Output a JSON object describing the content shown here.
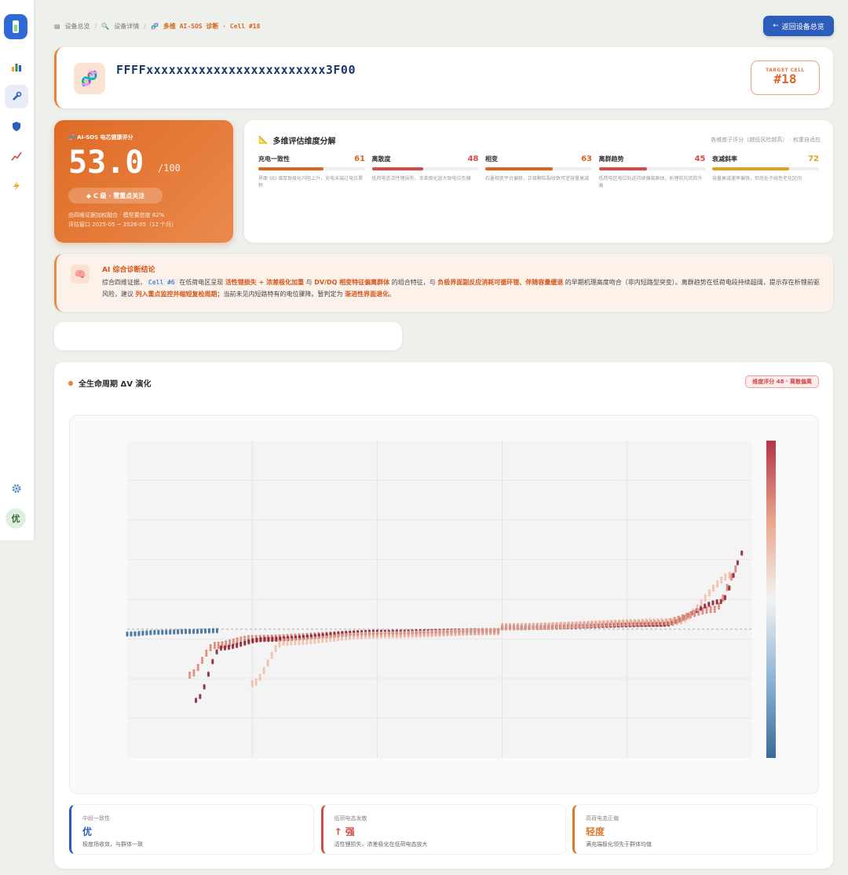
{
  "breadcrumb": {
    "items": [
      {
        "icon": "grid-icon",
        "label": "设备总览"
      },
      {
        "icon": "search-icon",
        "label": "设备详情"
      },
      {
        "icon": "dna-icon",
        "label": "多维 AI-SOS 诊断 · Cell #18"
      }
    ],
    "back_label": "返回设备总览"
  },
  "sidebar": {
    "avatar_label": "优"
  },
  "header": {
    "device_id": "FFFFxxxxxxxxxxxxxxxxxxxxxxxx3F00",
    "target_label": "TARGET CELL",
    "target_value": "#18"
  },
  "score": {
    "title": "AI-SOS 电芯健康评分",
    "value": "53.0",
    "max": "/100",
    "grade": "C 级 · 需重点关注",
    "meta1": "由四维证据加权融合 · 模型置信度 82%",
    "meta2": "评估窗口 2025-05 ~ 2026-05（12 个月）"
  },
  "dimensions": {
    "title": "多维评估维度分解",
    "note": "各维度子评分（越低风险越高） · 权重自适应",
    "items": [
      {
        "name": "充电一致性",
        "score": "61",
        "fraction": 0.61,
        "color": "#d9651f",
        "desc": "界面 SEI 增厚致极化内阻上升，充电末端过电位累积"
      },
      {
        "name": "离散度",
        "score": "48",
        "fraction": 0.48,
        "color": "#d74a4a",
        "desc": "低荷电态活性锂损失，浓差极化放大致电位负偏"
      },
      {
        "name": "相变",
        "score": "63",
        "fraction": 0.63,
        "color": "#d9651f",
        "desc": "石墨相变平台偏移，正极颗粒裂纹致可逆容量衰减"
      },
      {
        "name": "离群趋势",
        "score": "45",
        "fraction": 0.45,
        "color": "#d74a4a",
        "desc": "低荷电区电位轨迹持续偏离群体，析锂前兆风险升高"
      },
      {
        "name": "衰减斜率",
        "score": "72",
        "fraction": 0.72,
        "color": "#e0a21e",
        "desc": "容量衰减速率偏快，但尚处于线性老化区间"
      }
    ]
  },
  "diagnosis": {
    "title": "AI 综合诊断结论",
    "p1": "综合四维证据，",
    "cell": "Cell #6",
    "p2": " 在低荷电区呈现 ",
    "h1": "活性锂损失 + 浓差极化加重",
    "p3": " 与 ",
    "h2": "DV/DQ 相变特征偏离群体",
    "p4": " 的组合特征，与 ",
    "h3": "负极界面副反应消耗可循环锂、伴随容量缓退",
    "p5": " 的早期机理高度吻合（非内短路型突变）。离群趋势在低荷电段持续超阈，提示存在析锂前驱风险，建议 ",
    "h4": "列入重点监控并缩短复检周期",
    "p6": "；当前未见内短路特有的电位骤降。暂判定为 ",
    "h5": "渐进性界面退化",
    "p7": "。"
  },
  "chart_panel": {
    "title": "全生命周期 ΔV 演化",
    "badge": "维度评分 48 · 离散偏离"
  },
  "chart_data": {
    "type": "scatter",
    "title": "",
    "xlabel": "",
    "ylabel": "",
    "grid": true,
    "colorbar": {
      "colors": [
        "#b3344a",
        "#e9a58c",
        "#f3f3f3",
        "#8fb4d4",
        "#3b6b98"
      ]
    },
    "series": [
      {
        "color": "#3b6b98",
        "values": [
          [
            0.0,
            -0.02
          ],
          [
            0.05,
            -0.01
          ],
          [
            0.1,
            -0.005
          ],
          [
            0.15,
            0.0
          ]
        ]
      },
      {
        "color": "#d6735e",
        "values": [
          [
            0.1,
            -0.25
          ],
          [
            0.14,
            -0.08
          ],
          [
            0.2,
            -0.04
          ],
          [
            0.4,
            -0.01
          ],
          [
            0.6,
            0.0
          ],
          [
            0.85,
            0.02
          ],
          [
            0.94,
            0.1
          ],
          [
            0.98,
            0.35
          ]
        ]
      },
      {
        "color": "#8a2036",
        "values": [
          [
            0.11,
            -0.4
          ],
          [
            0.15,
            -0.1
          ],
          [
            0.22,
            -0.05
          ],
          [
            0.4,
            -0.01
          ],
          [
            0.6,
            0.0
          ],
          [
            0.86,
            0.02
          ],
          [
            0.95,
            0.15
          ],
          [
            0.99,
            0.45
          ]
        ]
      },
      {
        "color": "#f0b59d",
        "values": [
          [
            0.2,
            -0.3
          ],
          [
            0.25,
            -0.06
          ],
          [
            0.4,
            -0.02
          ],
          [
            0.6,
            0.0
          ],
          [
            0.88,
            0.03
          ],
          [
            0.97,
            0.3
          ]
        ]
      }
    ]
  },
  "summary_cards": [
    {
      "label": "中段一致性",
      "value": "优",
      "desc": "极度场收敛，与群体一致",
      "accent": "#2d5dba"
    },
    {
      "label": "低荷电态发散",
      "value": "↑ 强",
      "desc": "活性锂损失，浓差极化在低荷电态放大",
      "accent": "#d74a4a"
    },
    {
      "label": "高荷电态正偏",
      "value": "轻度",
      "desc": "满充端极化领先于群体均值",
      "accent": "#e0772f"
    }
  ]
}
